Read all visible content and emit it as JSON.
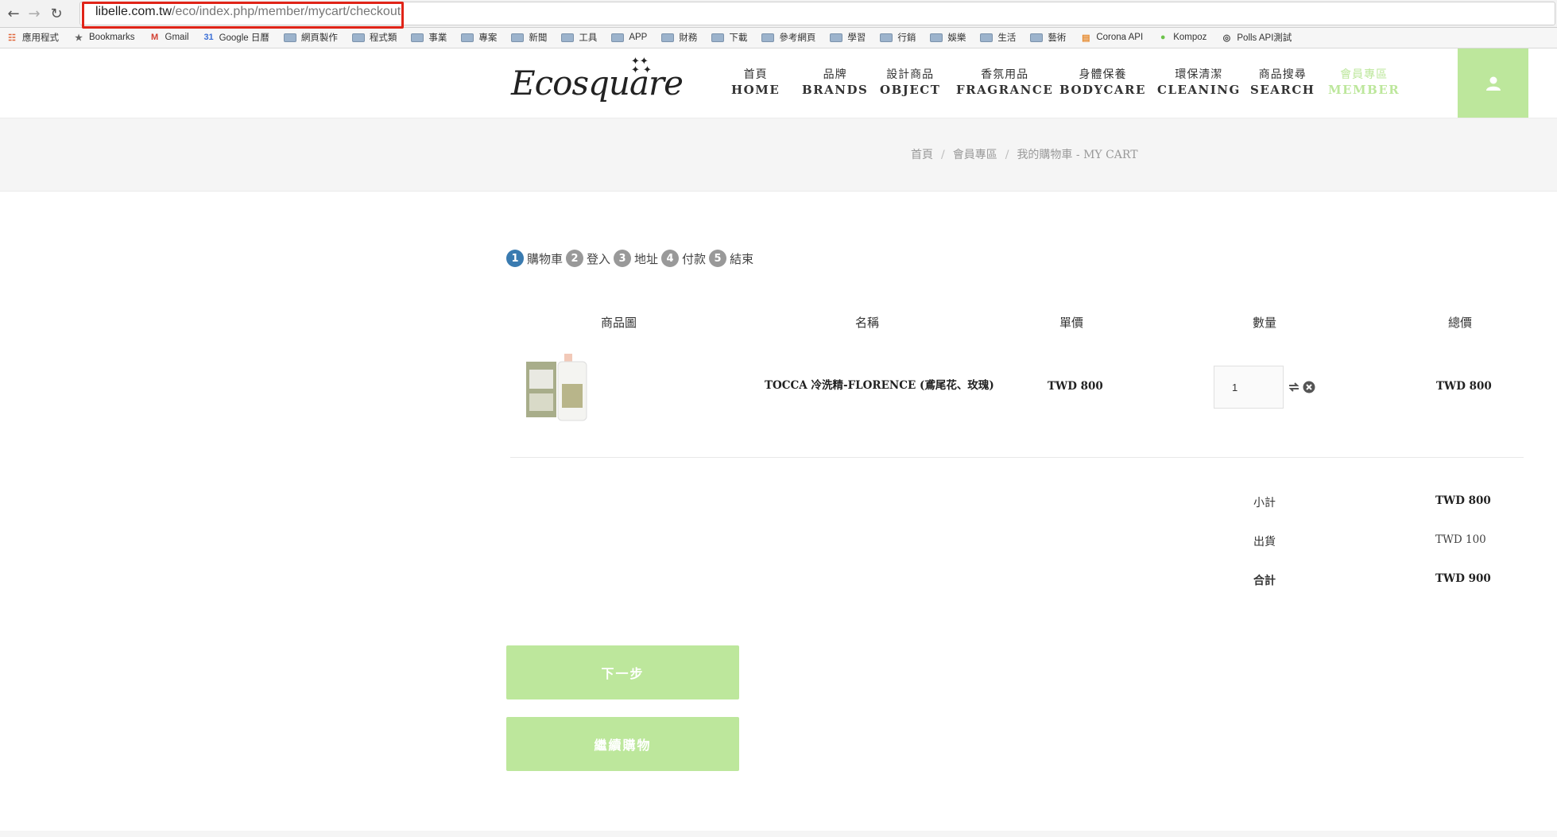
{
  "browser": {
    "url_host": "libelle.com.tw",
    "url_path": "/eco/index.php/member/mycart/checkout",
    "bookmarks": [
      {
        "label": "應用程式",
        "icon": "apps-grid-icon"
      },
      {
        "label": "Bookmarks",
        "icon": "star-icon"
      },
      {
        "label": "Gmail",
        "icon": "gmail-icon"
      },
      {
        "label": "Google 日曆",
        "icon": "calendar-icon"
      },
      {
        "label": "網頁製作",
        "icon": "folder-icon"
      },
      {
        "label": "程式類",
        "icon": "folder-icon"
      },
      {
        "label": "事業",
        "icon": "folder-icon"
      },
      {
        "label": "專案",
        "icon": "folder-icon"
      },
      {
        "label": "新聞",
        "icon": "folder-icon"
      },
      {
        "label": "工具",
        "icon": "folder-icon"
      },
      {
        "label": "APP",
        "icon": "folder-icon"
      },
      {
        "label": "財務",
        "icon": "folder-icon"
      },
      {
        "label": "下載",
        "icon": "folder-icon"
      },
      {
        "label": "參考網頁",
        "icon": "folder-icon"
      },
      {
        "label": "學習",
        "icon": "folder-icon"
      },
      {
        "label": "行銷",
        "icon": "folder-icon"
      },
      {
        "label": "娛樂",
        "icon": "folder-icon"
      },
      {
        "label": "生活",
        "icon": "folder-icon"
      },
      {
        "label": "藝術",
        "icon": "folder-icon"
      },
      {
        "label": "Corona API",
        "icon": "page-icon"
      },
      {
        "label": "Kompoz",
        "icon": "kompoz-icon"
      },
      {
        "label": "Polls API測試",
        "icon": "github-icon"
      }
    ]
  },
  "header": {
    "logo": "Ecosquare",
    "nav": [
      {
        "zh": "首頁",
        "en": "HOME"
      },
      {
        "zh": "品牌",
        "en": "BRANDS"
      },
      {
        "zh": "設計商品",
        "en": "OBJECT"
      },
      {
        "zh": "香氛用品",
        "en": "FRAGRANCE"
      },
      {
        "zh": "身體保養",
        "en": "BODYCARE"
      },
      {
        "zh": "環保清潔",
        "en": "CLEANING"
      },
      {
        "zh": "商品搜尋",
        "en": "SEARCH"
      },
      {
        "zh": "會員專區",
        "en": "MEMBER"
      }
    ],
    "accent_color": "#bde79c"
  },
  "breadcrumb": [
    "首頁",
    "會員專區",
    "我的購物車 - MY CART"
  ],
  "steps": [
    {
      "num": "1",
      "label": "購物車"
    },
    {
      "num": "2",
      "label": "登入"
    },
    {
      "num": "3",
      "label": "地址"
    },
    {
      "num": "4",
      "label": "付款"
    },
    {
      "num": "5",
      "label": "結束"
    }
  ],
  "cart": {
    "headers": [
      "商品圖",
      "名稱",
      "單價",
      "數量",
      "總價"
    ],
    "item": {
      "name": "TOCCA 冷洗精-FLORENCE (鳶尾花、玫瑰)",
      "unit_price": "TWD 800",
      "quantity": "1",
      "total": "TWD 800"
    },
    "summary": [
      {
        "label": "小計",
        "value": "TWD 800"
      },
      {
        "label": "出貨",
        "value": "TWD 100"
      },
      {
        "label": "合計",
        "value": "TWD 900"
      }
    ]
  },
  "buttons": {
    "next": "下一步",
    "continue": "繼續購物"
  }
}
